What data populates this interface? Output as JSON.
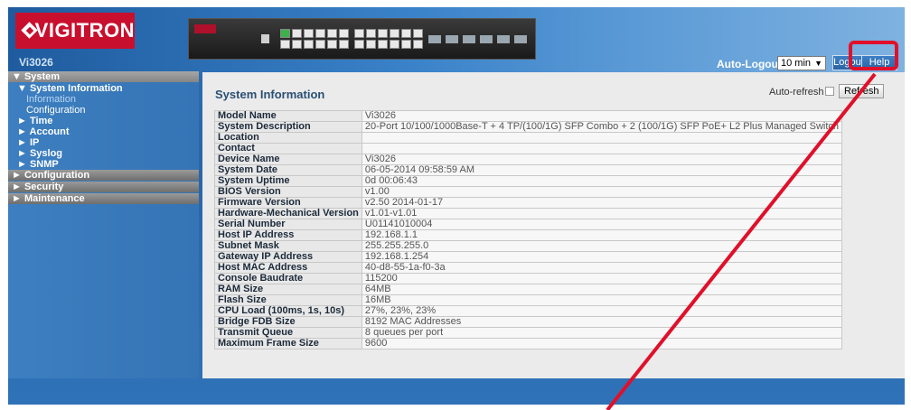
{
  "header": {
    "logo_text": "VIGITRON",
    "model": "Vi3026",
    "auto_logout_label": "Auto-Logout",
    "auto_logout_value": "10 min",
    "logout_label": "Logout",
    "help_label": "Help",
    "switch_brand_icon": "switch-front-panel-image"
  },
  "sidebar": {
    "system_label": "▼ System",
    "system_information_label": "▼ System Information",
    "information_label": "Information",
    "configuration_sub_label": "Configuration",
    "items": [
      {
        "label": "► Time"
      },
      {
        "label": "► Account"
      },
      {
        "label": "► IP"
      },
      {
        "label": "► Syslog"
      },
      {
        "label": "► SNMP"
      }
    ],
    "top_sections": [
      {
        "label": "► Configuration"
      },
      {
        "label": "► Security"
      },
      {
        "label": "► Maintenance"
      }
    ]
  },
  "main": {
    "title": "System Information",
    "auto_refresh_label": "Auto-refresh",
    "refresh_label": "Refresh"
  },
  "table": [
    {
      "key": "Model Name",
      "value": "Vi3026"
    },
    {
      "key": "System Description",
      "value": "20-Port 10/100/1000Base-T + 4 TP/(100/1G) SFP Combo + 2 (100/1G) SFP PoE+ L2 Plus Managed Switch"
    },
    {
      "key": "Location",
      "value": ""
    },
    {
      "key": "Contact",
      "value": ""
    },
    {
      "key": "Device Name",
      "value": "Vi3026"
    },
    {
      "key": "System Date",
      "value": "06-05-2014 09:58:59 AM"
    },
    {
      "key": "System Uptime",
      "value": "0d 00:06:43"
    },
    {
      "key": "BIOS Version",
      "value": "v1.00"
    },
    {
      "key": "Firmware Version",
      "value": "v2.50 2014-01-17"
    },
    {
      "key": "Hardware-Mechanical Version",
      "value": "v1.01-v1.01"
    },
    {
      "key": "Serial Number",
      "value": "U01141010004"
    },
    {
      "key": "Host IP Address",
      "value": "192.168.1.1"
    },
    {
      "key": "Subnet Mask",
      "value": "255.255.255.0"
    },
    {
      "key": "Gateway IP Address",
      "value": "192.168.1.254"
    },
    {
      "key": "Host MAC Address",
      "value": "40-d8-55-1a-f0-3a"
    },
    {
      "key": "Console Baudrate",
      "value": "115200"
    },
    {
      "key": "RAM Size",
      "value": "64MB"
    },
    {
      "key": "Flash Size",
      "value": "16MB"
    },
    {
      "key": "CPU Load (100ms, 1s, 10s)",
      "value": "27%, 23%, 23%"
    },
    {
      "key": "Bridge FDB Size",
      "value": "8192 MAC Addresses"
    },
    {
      "key": "Transmit Queue",
      "value": "8 queues per port"
    },
    {
      "key": "Maximum Frame Size",
      "value": "9600"
    }
  ],
  "colors": {
    "frame_blue": "#2d6fb3",
    "annotation_red": "#e0102a",
    "logo_red": "#c8102e"
  }
}
